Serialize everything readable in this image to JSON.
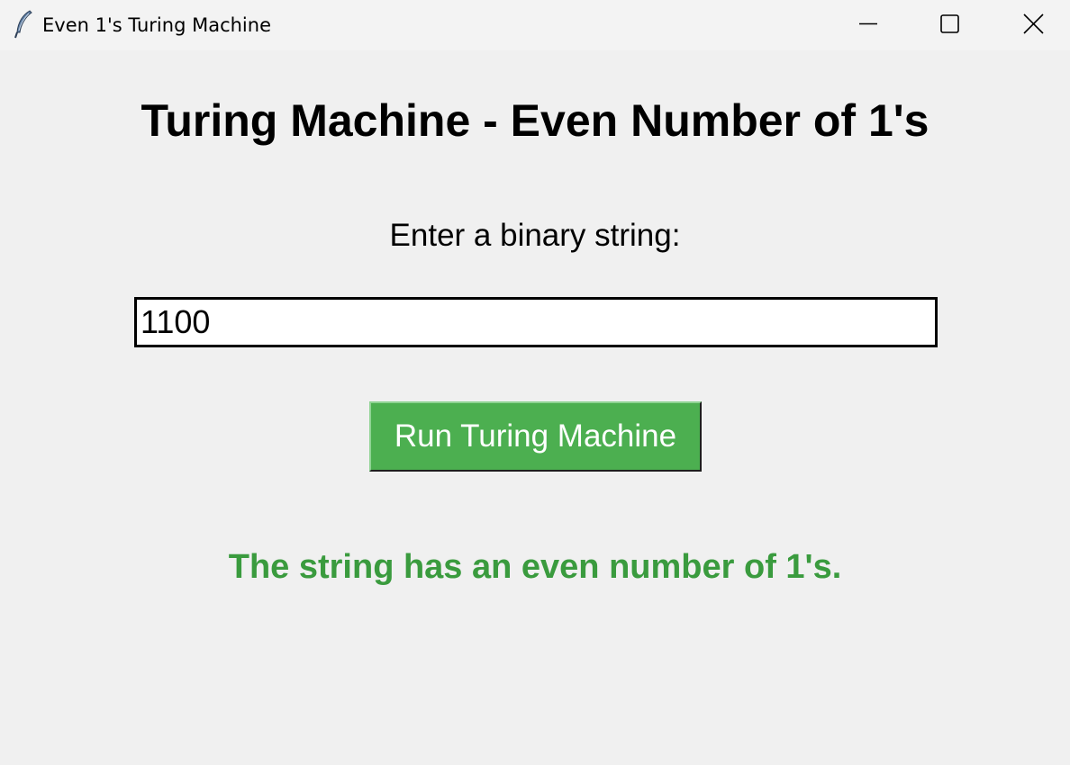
{
  "window": {
    "title": "Even 1's Turing Machine",
    "icon": "feather-icon",
    "controls": [
      "minimize-icon",
      "maximize-icon",
      "close-icon"
    ]
  },
  "main": {
    "heading": "Turing Machine - Even Number of 1's",
    "prompt": "Enter a binary string:",
    "input_value": "1100",
    "button_label": "Run Turing Machine",
    "result": "The string has an even number of 1's."
  },
  "colors": {
    "button_bg": "#4caf50",
    "button_text": "#ffffff",
    "result_text": "#3a9b3e"
  }
}
